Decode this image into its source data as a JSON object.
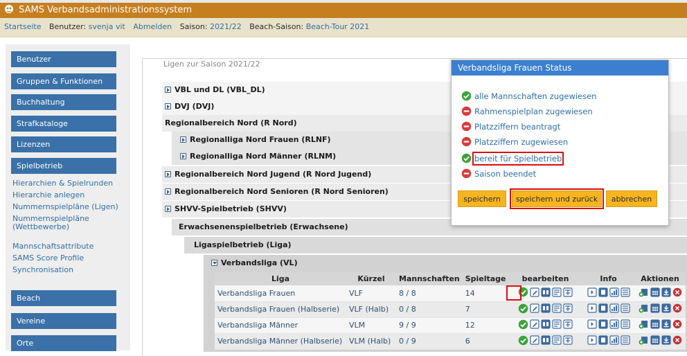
{
  "app": {
    "title": "SAMS Verbandsadministrationssystem"
  },
  "nav": {
    "home": "Startseite",
    "user_label": "Benutzer:",
    "user_name": "svenja vit",
    "logout": "Abmelden",
    "season_label": "Saison:",
    "season": "2021/22",
    "beach_label": "Beach-Saison:",
    "beach_season": "Beach-Tour 2021"
  },
  "sidebar": {
    "buttons": [
      "Benutzer",
      "Gruppen & Funktionen",
      "Buchhaltung",
      "Strafkataloge",
      "Lizenzen",
      "Spielbetrieb"
    ],
    "links": [
      "Hierarchien & Spielrunden",
      "Hierarchie anlegen",
      "Nummernspielpläne (Ligen)",
      "Nummernspielpläne (Wettbewerbe)",
      "Mannschaftsattribute",
      "SAMS Score Profile",
      "Synchronisation"
    ],
    "buttons2": [
      "Beach",
      "Vereine",
      "Orte"
    ]
  },
  "main": {
    "legend": "Ligen zur Saison 2021/22",
    "tree": [
      "VBL und DL (VBL_DL)",
      "DVJ (DVJ)",
      "Regionalbereich Nord (R Nord)",
      "Regionalliga Nord Frauen (RLNF)",
      "Regionalliga Nord Männer (RLNM)",
      "Regionalbereich Nord Jugend (R Nord Jugend)",
      "Regionalbereich Nord Senioren (R Nord Senioren)",
      "SHVV-Spielbetrieb (SHVV)",
      "Erwachsenenspielbetrieb (Erwachsene)",
      "Ligaspielbetrieb (Liga)",
      "Verbandsliga (VL)"
    ]
  },
  "table": {
    "headers": [
      "Liga",
      "Kürzel",
      "Mannschaften",
      "Spieltage",
      "bearbeiten",
      "Info",
      "Aktionen"
    ],
    "rows": [
      [
        "Verbandsliga Frauen",
        "VLF",
        "8 / 8",
        "14"
      ],
      [
        "Verbandsliga Frauen (Halbserie)",
        "VLF (Halb)",
        "0 / 8",
        "7"
      ],
      [
        "Verbandsliga Männer",
        "VLM",
        "9 / 9",
        "12"
      ],
      [
        "Verbandsliga Männer (Halbserie)",
        "VLM (Halb)",
        "0 / 9",
        "6"
      ]
    ]
  },
  "dialog": {
    "title": "Verbandsliga Frauen Status",
    "items": [
      {
        "label": "alle Mannschaften zugewiesen",
        "status": "ok"
      },
      {
        "label": "Rahmenspielplan zugewiesen",
        "status": "no"
      },
      {
        "label": "Platzziffern beantragt",
        "status": "no"
      },
      {
        "label": "Platzziffern zugewiesen",
        "status": "no"
      },
      {
        "label": "bereit für Spielbetrieb",
        "status": "ok"
      },
      {
        "label": "Saison beendet",
        "status": "no"
      }
    ],
    "buttons": {
      "save": "speichern",
      "save_back": "speichern und zurück",
      "cancel": "abbrechen"
    }
  },
  "colors": {
    "title_bar": "#c57f1f",
    "sidebar_button": "#3a71a8",
    "dialog_header": "#3b7fd1",
    "dialog_button": "#f6b51e",
    "ok": "#3aa33a",
    "no": "#d93b3b",
    "highlight": "#d80e0e"
  }
}
